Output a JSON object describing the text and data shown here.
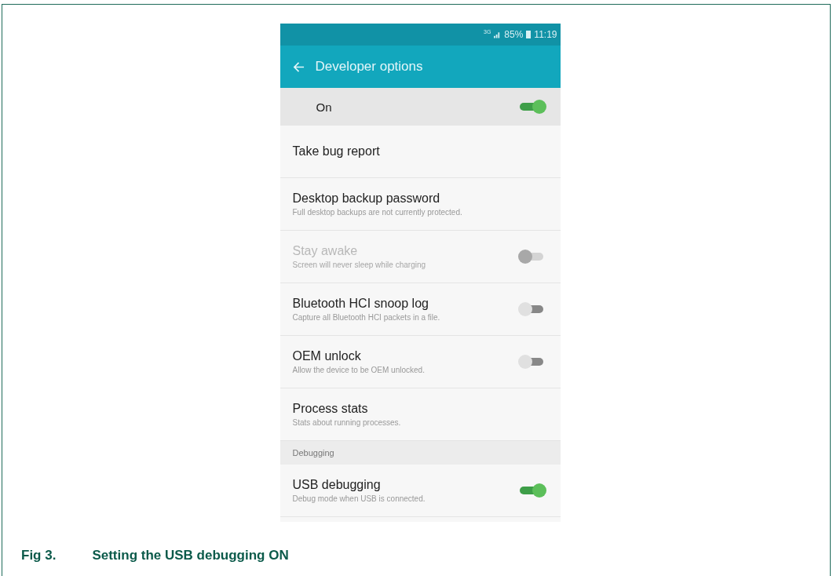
{
  "status_bar": {
    "network": "3G",
    "battery": "85%",
    "time": "11:19"
  },
  "toolbar": {
    "title": "Developer options"
  },
  "master_switch": {
    "label": "On",
    "on": true
  },
  "settings": [
    {
      "kind": "plain",
      "title": "Take bug report"
    },
    {
      "kind": "plain",
      "title": "Desktop backup password",
      "summary": "Full desktop backups are not currently protected."
    },
    {
      "kind": "toggle",
      "title": "Stay awake",
      "summary": "Screen will never sleep while charging",
      "on": false,
      "disabled": true
    },
    {
      "kind": "toggle",
      "title": "Bluetooth HCI snoop log",
      "summary": "Capture all Bluetooth HCI packets in a file.",
      "on": false,
      "disabled": false
    },
    {
      "kind": "toggle",
      "title": "OEM unlock",
      "summary": "Allow the device to be OEM unlocked.",
      "on": false,
      "disabled": false
    },
    {
      "kind": "plain",
      "title": "Process stats",
      "summary": "Stats about running processes."
    },
    {
      "kind": "header",
      "title": "Debugging"
    },
    {
      "kind": "toggle",
      "title": "USB debugging",
      "summary": "Debug mode when USB is connected.",
      "on": true,
      "disabled": false
    }
  ],
  "caption": {
    "number": "Fig 3.",
    "text": "Setting the USB debugging ON"
  }
}
